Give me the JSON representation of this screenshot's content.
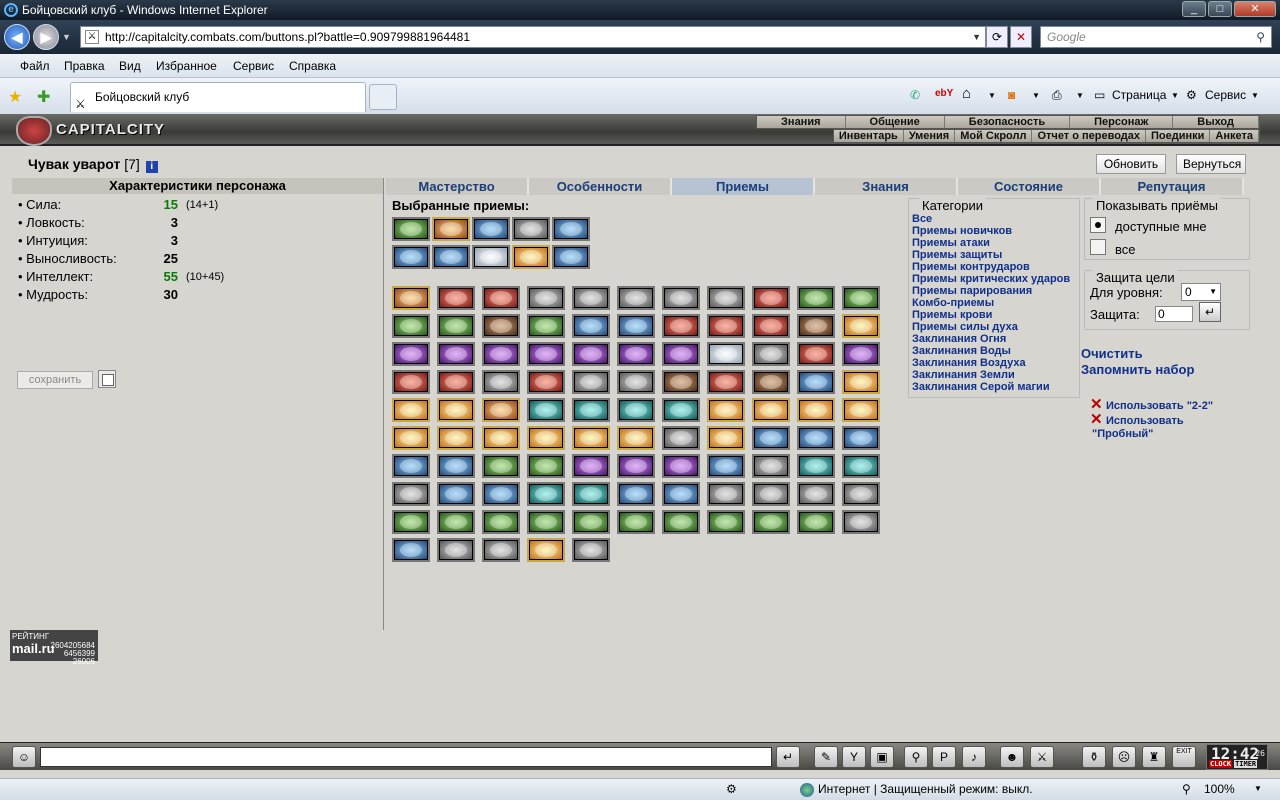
{
  "window": {
    "title": "Бойцовский клуб - Windows Internet Explorer"
  },
  "browser": {
    "url": "http://capitalcity.combats.com/buttons.pl?battle=0.909799881964481",
    "search_placeholder": "Google",
    "menu": [
      "Файл",
      "Правка",
      "Вид",
      "Избранное",
      "Сервис",
      "Справка"
    ],
    "tab_title": "Бойцовский клуб",
    "cmd_page": "Страница",
    "cmd_service": "Сервис"
  },
  "game": {
    "logo": "CAPITALCITY",
    "topnav": [
      "Знания",
      "Общение",
      "Безопасность",
      "Персонаж",
      "Выход"
    ],
    "subnav": [
      "Инвентарь",
      "Умения",
      "Мой Скролл",
      "Отчет о переводах",
      "Поединки",
      "Анкета"
    ],
    "char_name": "Чувак уварот",
    "char_level": "[7]",
    "info_icon": "i",
    "btn_refresh": "Обновить",
    "btn_back": "Вернуться",
    "stats_header": "Характеристики персонажа",
    "stats": [
      {
        "name": "• Сила:",
        "value": "15",
        "extra": "(14+1)",
        "green": true
      },
      {
        "name": "• Ловкость:",
        "value": "3",
        "extra": "",
        "green": false
      },
      {
        "name": "• Интуиция:",
        "value": "3",
        "extra": "",
        "green": false
      },
      {
        "name": "• Выносливость:",
        "value": "25",
        "extra": "",
        "green": false
      },
      {
        "name": "• Интеллект:",
        "value": "55",
        "extra": "(10+45)",
        "green": true
      },
      {
        "name": "• Мудрость:",
        "value": "30",
        "extra": "",
        "green": false
      }
    ],
    "save_label": "сохранить",
    "tabs": [
      "Мастерство",
      "Особенности",
      "Приемы",
      "Знания",
      "Состояние",
      "Репутация"
    ],
    "active_tab": 2,
    "selected_header": "Выбранные приемы:",
    "categories_title": "Категории",
    "categories": [
      "Все",
      "Приемы новичков",
      "Приемы атаки",
      "Приемы защиты",
      "Приемы контрударов",
      "Приемы критических ударов",
      "Приемы парирования",
      "Комбо-приемы",
      "Приемы крови",
      "Приемы силы духа",
      "Заклинания Огня",
      "Заклинания Воды",
      "Заклинания Воздуха",
      "Заклинания Земли",
      "Заклинания Серой магии"
    ],
    "show_title": "Показывать приёмы",
    "show_available": "доступные мне",
    "show_all": "все",
    "protect_title": "Защита цели",
    "protect_level_label": "Для уровня:",
    "protect_level_value": "0",
    "protect_label": "Защита:",
    "protect_value": "0",
    "clear_link": "Очистить",
    "remember_link": "Запомнить набор",
    "use_22": "Использовать \"2-2\"",
    "use_probny_1": "Использовать",
    "use_probny_2": "\"Пробный\"",
    "rating_label": "РЕЙТИНГ",
    "rating_mail": "mail.ru",
    "rating_nums": [
      "2604205684",
      "6456399",
      "26006"
    ],
    "selected_skills": [
      [
        "c-green",
        "c-orange",
        "c-blue",
        "c-gray",
        "c-blue"
      ],
      [
        "c-blue",
        "c-blue",
        "c-light",
        "c-fire",
        "c-blue"
      ]
    ],
    "all_skills": [
      [
        "c-orange",
        "c-red",
        "c-red",
        "c-gray",
        "c-gray",
        "c-gray",
        "c-gray",
        "c-gray",
        "c-red",
        "c-green",
        "c-green"
      ],
      [
        "c-green",
        "c-green",
        "c-brown",
        "c-green",
        "c-blue",
        "c-blue",
        "c-red",
        "c-red",
        "c-red",
        "c-brown",
        "c-fire"
      ],
      [
        "c-purple",
        "c-purple",
        "c-purple",
        "c-purple",
        "c-purple",
        "c-purple",
        "c-purple",
        "c-light",
        "c-gray",
        "c-red",
        "c-purple"
      ],
      [
        "c-red",
        "c-red",
        "c-gray",
        "c-red",
        "c-gray",
        "c-gray",
        "c-brown",
        "c-red",
        "c-brown",
        "c-blue",
        "c-fire"
      ],
      [
        "c-fire",
        "c-fire",
        "c-orange",
        "c-teal",
        "c-teal",
        "c-teal",
        "c-teal",
        "c-fire",
        "c-fire",
        "c-fire",
        "c-fire"
      ],
      [
        "c-fire",
        "c-fire",
        "c-fire",
        "c-fire",
        "c-fire",
        "c-fire",
        "c-gray",
        "c-fire",
        "c-blue",
        "c-blue",
        "c-blue"
      ],
      [
        "c-blue",
        "c-blue",
        "c-green",
        "c-green",
        "c-purple",
        "c-purple",
        "c-purple",
        "c-blue",
        "c-gray",
        "c-teal",
        "c-teal"
      ],
      [
        "c-gray",
        "c-blue",
        "c-blue",
        "c-teal",
        "c-teal",
        "c-blue",
        "c-blue",
        "c-gray",
        "c-gray",
        "c-gray",
        "c-gray"
      ],
      [
        "c-green",
        "c-green",
        "c-green",
        "c-green",
        "c-green",
        "c-green",
        "c-green",
        "c-green",
        "c-green",
        "c-green",
        "c-gray"
      ],
      [
        "c-blue",
        "c-gray",
        "c-gray",
        "c-fire",
        "c-gray"
      ]
    ],
    "icons": [
      "chat-icon",
      "enter-icon",
      "clock-icon"
    ]
  },
  "clock": {
    "time": "12:42",
    "seconds": "26",
    "clock_label": "CLOCK",
    "timer_label": "TIMER"
  },
  "status": {
    "zone": "Интернет | Защищенный режим: выкл.",
    "zoom": "100%"
  }
}
